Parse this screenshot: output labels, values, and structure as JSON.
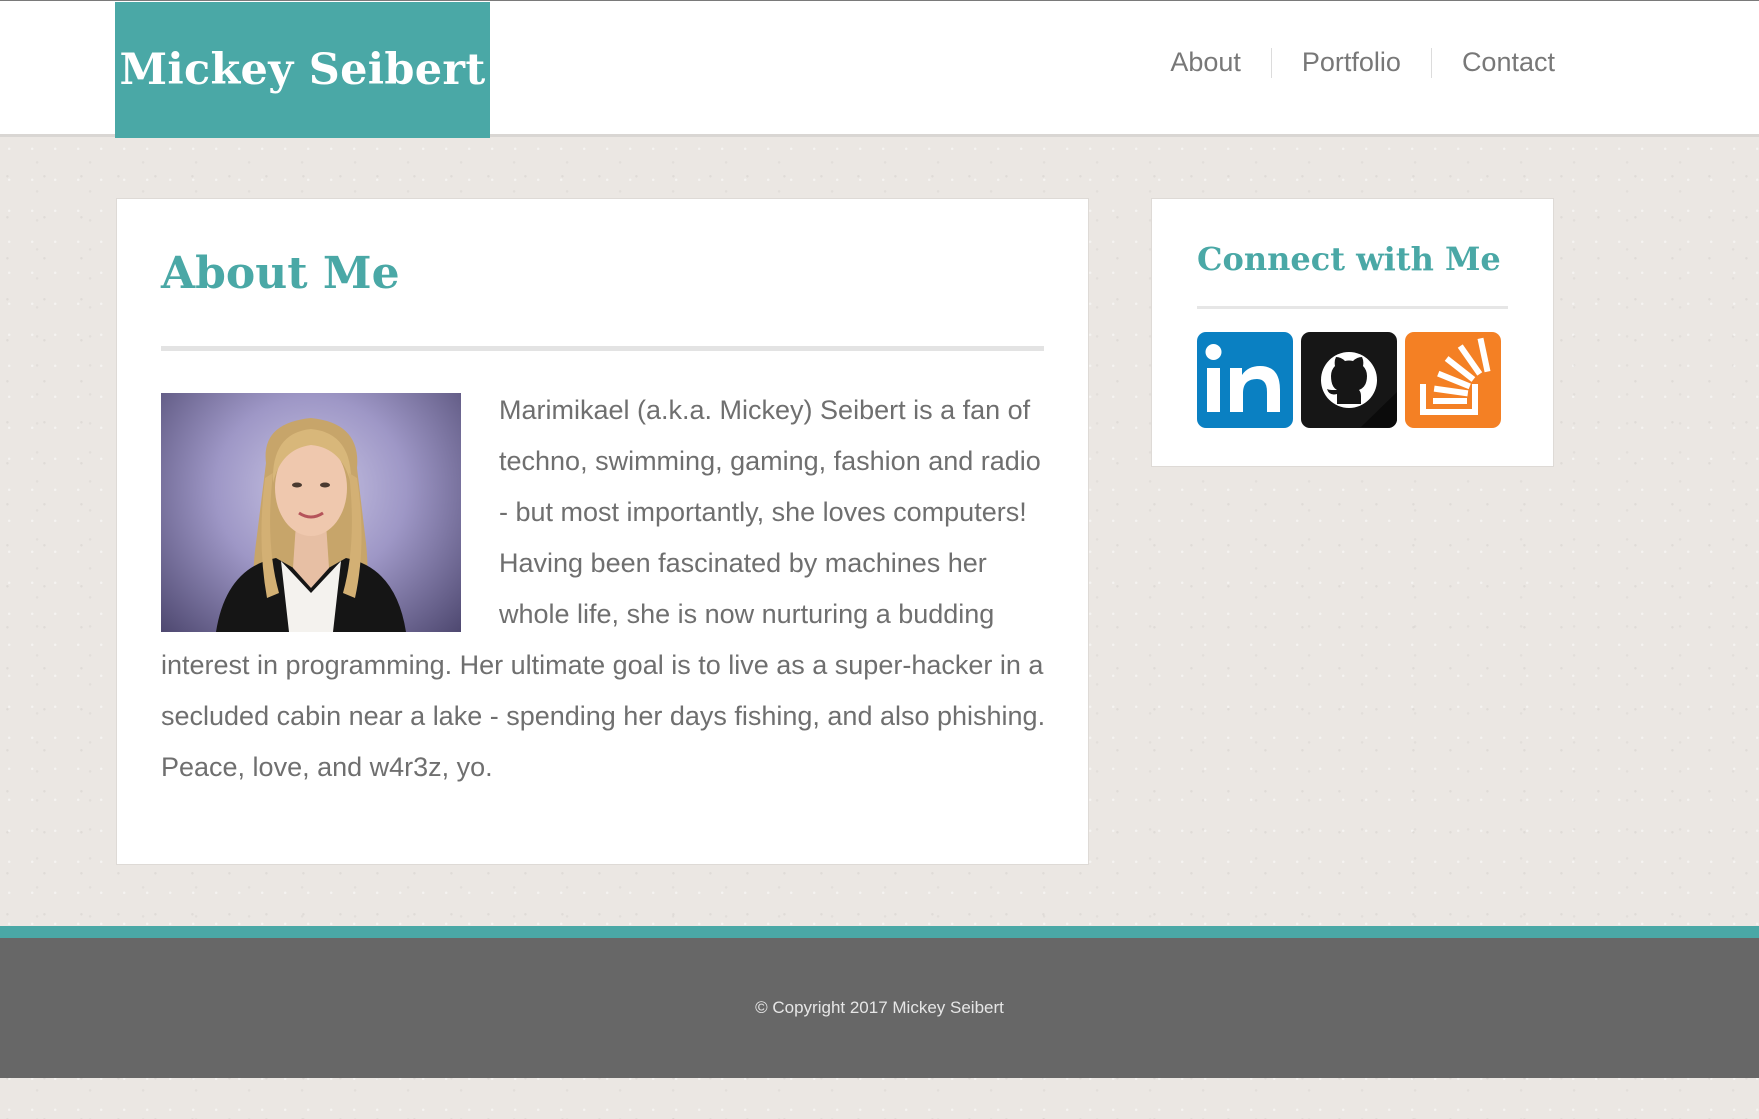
{
  "header": {
    "logo": "Mickey Seibert",
    "nav": [
      {
        "label": "About"
      },
      {
        "label": "Portfolio"
      },
      {
        "label": "Contact"
      }
    ]
  },
  "about": {
    "title": "About Me",
    "photo_icon": "profile-photo",
    "bio": "Marimikael (a.k.a. Mickey) Seibert is a fan of techno, swimming, gaming, fashion and radio - but most importantly, she loves computers! Having been fascinated by machines her whole life, she is now nurturing a budding interest in programming. Her ultimate goal is to live as a super-hacker in a secluded cabin near a lake - spending her days fishing, and also phishing. Peace, love, and w4r3z, yo."
  },
  "connect": {
    "title": "Connect with Me",
    "links": [
      {
        "icon": "linkedin-icon",
        "label": "in"
      },
      {
        "icon": "github-icon"
      },
      {
        "icon": "stackoverflow-icon"
      }
    ]
  },
  "footer": {
    "copyright": "© Copyright 2017 Mickey Seibert"
  },
  "colors": {
    "accent": "#4aa8a6",
    "footer": "#676767",
    "text": "#6f6f6f",
    "linkedin": "#0a80c2",
    "github": "#161616",
    "stackoverflow": "#f48024"
  }
}
